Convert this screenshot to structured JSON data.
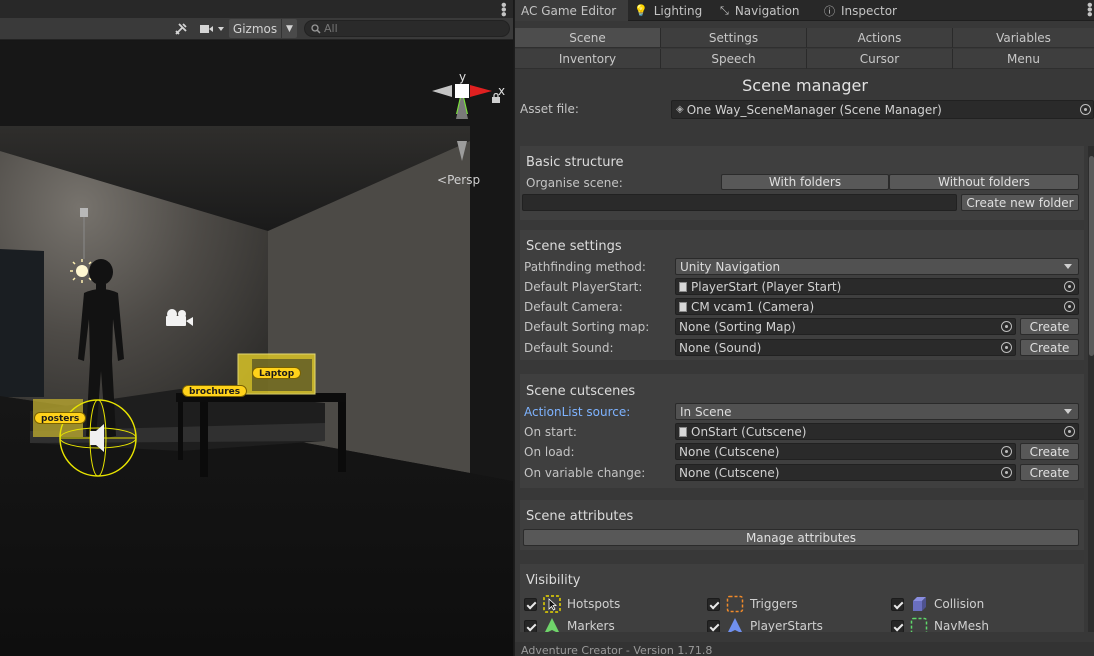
{
  "scene_view": {
    "gizmos_label": "Gizmos",
    "search_placeholder": "All",
    "persp_label": "Persp",
    "axis_y": "y",
    "axis_x": "x",
    "tags": {
      "laptop": "Laptop",
      "brochures": "brochures",
      "posters": "posters"
    }
  },
  "editor": {
    "tabs": [
      "AC Game Editor",
      "Lighting",
      "Navigation",
      "Inspector"
    ],
    "categories": [
      "Scene",
      "Settings",
      "Actions",
      "Variables",
      "Inventory",
      "Speech",
      "Cursor",
      "Menu"
    ],
    "title": "Scene manager",
    "asset_label": "Asset file:",
    "asset_value": "One Way_SceneManager (Scene Manager)",
    "basic": {
      "title": "Basic structure",
      "organise_label": "Organise scene:",
      "with_folders": "With folders",
      "without_folders": "Without folders",
      "folder_name": "",
      "create_folder": "Create new folder"
    },
    "settings": {
      "title": "Scene settings",
      "rows": [
        {
          "label": "Pathfinding method:",
          "value": "Unity Navigation"
        },
        {
          "label": "Default PlayerStart:",
          "value": "PlayerStart (Player Start)"
        },
        {
          "label": "Default Camera:",
          "value": "CM vcam1 (Camera)"
        },
        {
          "label": "Default Sorting map:",
          "value": "None (Sorting Map)"
        },
        {
          "label": "Default Sound:",
          "value": "None (Sound)"
        }
      ],
      "create_label": "Create"
    },
    "cutscenes": {
      "title": "Scene cutscenes",
      "rows": [
        {
          "label": "ActionList source:",
          "value": "In Scene"
        },
        {
          "label": "On start:",
          "value": "OnStart (Cutscene)"
        },
        {
          "label": "On load:",
          "value": "None (Cutscene)"
        },
        {
          "label": "On variable change:",
          "value": "None (Cutscene)"
        }
      ],
      "create_label": "Create"
    },
    "attributes": {
      "title": "Scene attributes",
      "manage": "Manage attributes"
    },
    "visibility": {
      "title": "Visibility",
      "items": [
        {
          "label": "Hotspots",
          "checked": true,
          "icon": "hotspot-icon"
        },
        {
          "label": "Triggers",
          "checked": true,
          "icon": "trigger-icon"
        },
        {
          "label": "Collision",
          "checked": true,
          "icon": "collision-icon"
        },
        {
          "label": "Markers",
          "checked": true,
          "icon": "marker-icon"
        },
        {
          "label": "PlayerStarts",
          "checked": true,
          "icon": "playerstart-icon"
        },
        {
          "label": "NavMesh",
          "checked": true,
          "icon": "navmesh-icon"
        }
      ]
    },
    "footer": "Adventure Creator - Version 1.71.8"
  },
  "colors": {
    "tag_yellow": "#ffd21a",
    "link_blue": "#7eb3ff",
    "gizmo_y": "#6ccf2b",
    "gizmo_x": "#e02020"
  }
}
